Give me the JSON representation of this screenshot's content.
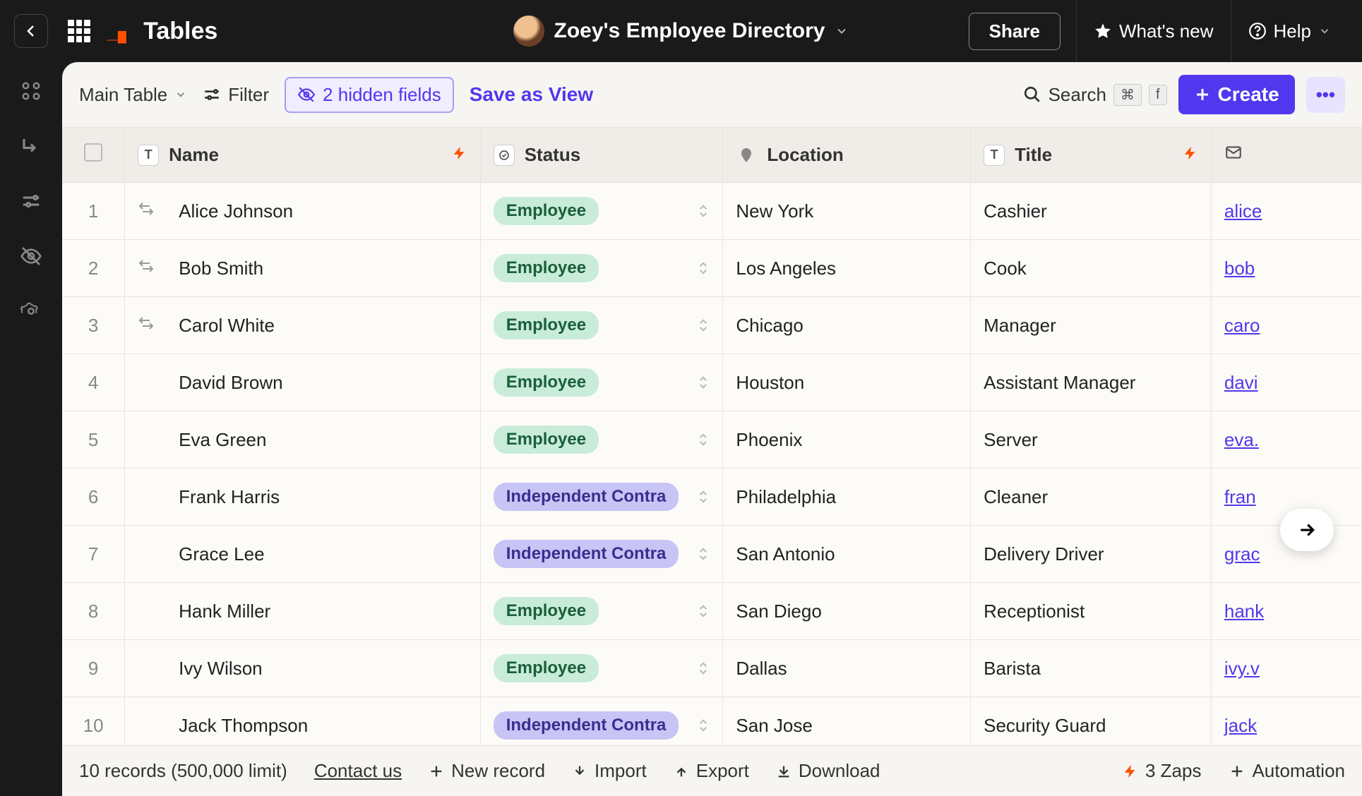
{
  "nav": {
    "app_name": "Tables",
    "table_title": "Zoey's Employee Directory",
    "share": "Share",
    "whats_new": "What's new",
    "help": "Help"
  },
  "toolbar": {
    "view_label": "Main Table",
    "filter_label": "Filter",
    "hidden_fields_label": "2 hidden fields",
    "save_view": "Save as View",
    "search_label": "Search",
    "kbd1": "⌘",
    "kbd2": "f",
    "create_label": "Create"
  },
  "columns": {
    "name": "Name",
    "status": "Status",
    "location": "Location",
    "title": "Title"
  },
  "rows": [
    {
      "num": "1",
      "swap": true,
      "name": "Alice Johnson",
      "status": "Employee",
      "status_class": "employee",
      "location": "New York",
      "title": "Cashier",
      "email": "alice"
    },
    {
      "num": "2",
      "swap": true,
      "name": "Bob Smith",
      "status": "Employee",
      "status_class": "employee",
      "location": "Los Angeles",
      "title": "Cook",
      "email": "bob"
    },
    {
      "num": "3",
      "swap": true,
      "name": "Carol White",
      "status": "Employee",
      "status_class": "employee",
      "location": "Chicago",
      "title": "Manager",
      "email": "caro"
    },
    {
      "num": "4",
      "swap": false,
      "name": "David Brown",
      "status": "Employee",
      "status_class": "employee",
      "location": "Houston",
      "title": "Assistant Manager",
      "email": "davi"
    },
    {
      "num": "5",
      "swap": false,
      "name": "Eva Green",
      "status": "Employee",
      "status_class": "employee",
      "location": "Phoenix",
      "title": "Server",
      "email": "eva."
    },
    {
      "num": "6",
      "swap": false,
      "name": "Frank Harris",
      "status": "Independent Contra",
      "status_class": "contractor",
      "location": "Philadelphia",
      "title": "Cleaner",
      "email": "fran"
    },
    {
      "num": "7",
      "swap": false,
      "name": "Grace Lee",
      "status": "Independent Contra",
      "status_class": "contractor",
      "location": "San Antonio",
      "title": "Delivery Driver",
      "email": "grac"
    },
    {
      "num": "8",
      "swap": false,
      "name": "Hank Miller",
      "status": "Employee",
      "status_class": "employee",
      "location": "San Diego",
      "title": "Receptionist",
      "email": "hank"
    },
    {
      "num": "9",
      "swap": false,
      "name": "Ivy Wilson",
      "status": "Employee",
      "status_class": "employee",
      "location": "Dallas",
      "title": "Barista",
      "email": "ivy.v"
    },
    {
      "num": "10",
      "swap": false,
      "name": "Jack Thompson",
      "status": "Independent Contra",
      "status_class": "contractor",
      "location": "San Jose",
      "title": "Security Guard",
      "email": "jack"
    }
  ],
  "footer": {
    "records": "10 records (500,000 limit)",
    "contact": "Contact us",
    "new_record": "New record",
    "import": "Import",
    "export": "Export",
    "download": "Download",
    "zaps": "3 Zaps",
    "automation": "Automation"
  }
}
